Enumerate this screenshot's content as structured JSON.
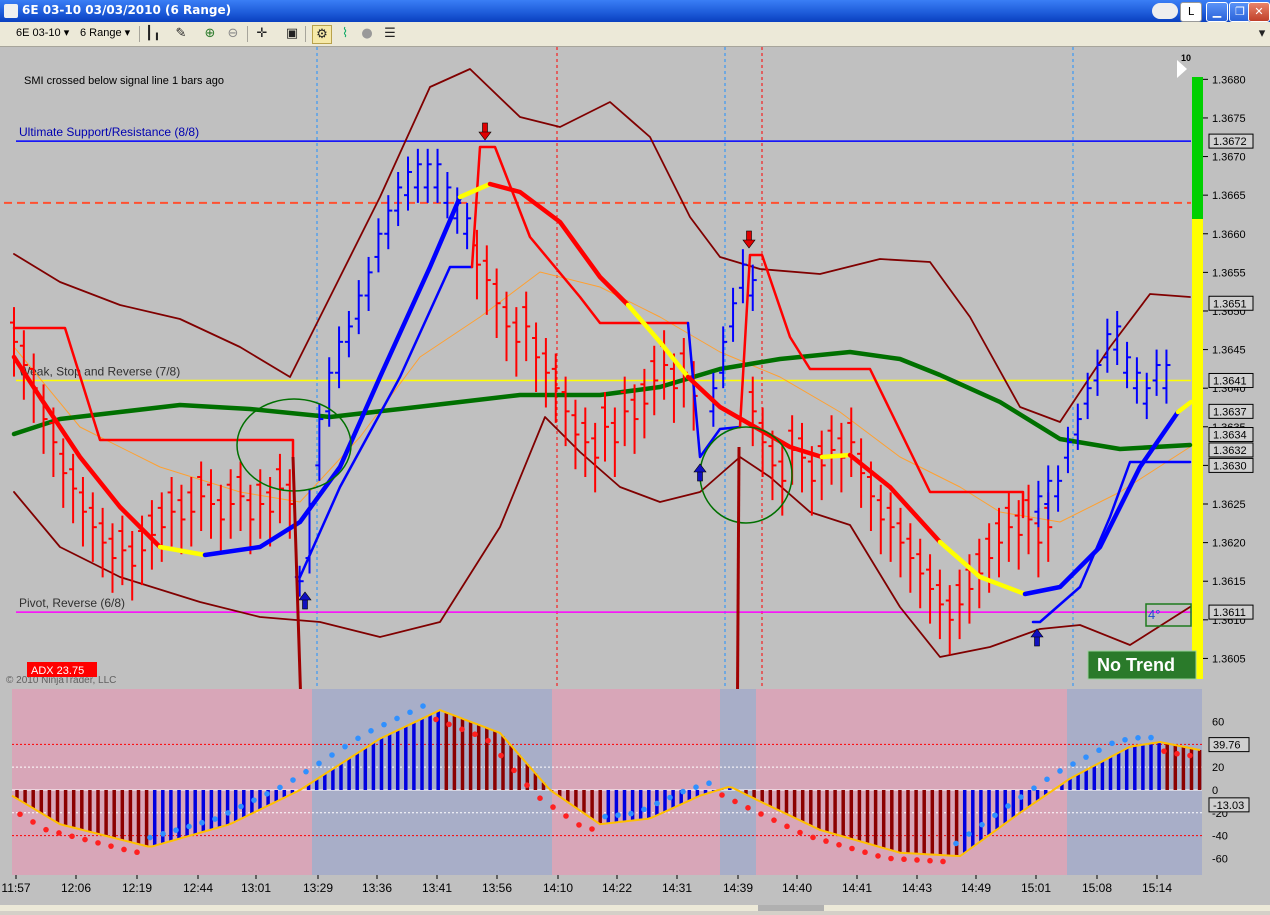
{
  "window": {
    "title": "6E 03-10  03/03/2010 (6 Range)",
    "button_restore": "L"
  },
  "toolbar": {
    "instrument": "6E 03-10",
    "bar_type": "6 Range"
  },
  "chart_data": [
    {
      "type": "line",
      "panel": "price",
      "status_message": "SMI crossed below signal line  1 bars ago",
      "copyright": "© 2010 NinjaTrader, LLC",
      "adx_label": "ADX 23.75",
      "trend_label": "No Trend",
      "angle_label": "4°",
      "corner_marker": "10",
      "ylim": [
        1.36013,
        1.36838
      ],
      "y_ticks": [
        "1.3680",
        "1.3675",
        "1.3670",
        "1.3665",
        "1.3660",
        "1.3655",
        "1.3650",
        "1.3645",
        "1.3640",
        "1.3635",
        "1.3630",
        "1.3625",
        "1.3620",
        "1.3615",
        "1.3610",
        "1.3605"
      ],
      "levels": [
        {
          "name": "Ultimate Support/Resistance (8/8)",
          "price": 1.3672,
          "color": "#0000ff"
        },
        {
          "name": "Weak, Stop and Reverse (7/8)",
          "price": 1.3641,
          "color": "#ffff00"
        },
        {
          "name": "Pivot, Reverse (6/8)",
          "price": 1.3611,
          "color": "#ff00ff"
        },
        {
          "name": "",
          "price": 1.3664,
          "color": "#ff5030",
          "dashed": true
        }
      ],
      "price_tags": [
        "1.3672",
        "1.3651",
        "1.3641",
        "1.3637",
        "1.3634",
        "1.3632",
        "1.3630",
        "1.3611"
      ],
      "bars_blue": [
        {
          "i": 29,
          "h": 1.3617,
          "l": 1.3613
        },
        {
          "i": 30,
          "h": 1.3627,
          "l": 1.3616
        },
        {
          "i": 31,
          "h": 1.3638,
          "l": 1.3628
        },
        {
          "i": 32,
          "h": 1.3644,
          "l": 1.3635
        },
        {
          "i": 33,
          "h": 1.3648,
          "l": 1.364
        },
        {
          "i": 34,
          "h": 1.365,
          "l": 1.3644
        },
        {
          "i": 35,
          "h": 1.3654,
          "l": 1.3647
        },
        {
          "i": 36,
          "h": 1.3657,
          "l": 1.365
        },
        {
          "i": 37,
          "h": 1.3662,
          "l": 1.3655
        },
        {
          "i": 38,
          "h": 1.3665,
          "l": 1.3658
        },
        {
          "i": 39,
          "h": 1.3668,
          "l": 1.3661
        },
        {
          "i": 40,
          "h": 1.367,
          "l": 1.3663
        },
        {
          "i": 41,
          "h": 1.3671,
          "l": 1.3664
        },
        {
          "i": 42,
          "h": 1.3671,
          "l": 1.3664
        },
        {
          "i": 43,
          "h": 1.3671,
          "l": 1.3664
        },
        {
          "i": 44,
          "h": 1.3668,
          "l": 1.3662
        },
        {
          "i": 45,
          "h": 1.3666,
          "l": 1.366
        },
        {
          "i": 46,
          "h": 1.3664,
          "l": 1.3658
        },
        {
          "i": 71,
          "h": 1.3642,
          "l": 1.3635
        },
        {
          "i": 72,
          "h": 1.3648,
          "l": 1.364
        },
        {
          "i": 73,
          "h": 1.3653,
          "l": 1.3646
        },
        {
          "i": 74,
          "h": 1.3658,
          "l": 1.3651
        },
        {
          "i": 75,
          "h": 1.3656,
          "l": 1.365
        },
        {
          "i": 104,
          "h": 1.3628,
          "l": 1.3622
        },
        {
          "i": 105,
          "h": 1.363,
          "l": 1.3623
        },
        {
          "i": 106,
          "h": 1.363,
          "l": 1.3624
        },
        {
          "i": 107,
          "h": 1.3635,
          "l": 1.3629
        },
        {
          "i": 108,
          "h": 1.3638,
          "l": 1.3632
        },
        {
          "i": 109,
          "h": 1.3642,
          "l": 1.3636
        },
        {
          "i": 110,
          "h": 1.3645,
          "l": 1.3639
        },
        {
          "i": 111,
          "h": 1.3649,
          "l": 1.3642
        },
        {
          "i": 112,
          "h": 1.365,
          "l": 1.3643
        },
        {
          "i": 113,
          "h": 1.3646,
          "l": 1.364
        },
        {
          "i": 114,
          "h": 1.3644,
          "l": 1.3638
        },
        {
          "i": 115,
          "h": 1.3642,
          "l": 1.3636
        },
        {
          "i": 116,
          "h": 1.3645,
          "l": 1.3639
        },
        {
          "i": 117,
          "h": 1.3645,
          "l": 1.3638
        }
      ],
      "red_close": [
        1.3646,
        1.3643,
        1.364,
        1.3636,
        1.3633,
        1.3629,
        1.3627,
        1.3624,
        1.3622,
        1.362,
        1.3618,
        1.3619,
        1.3617,
        1.3619,
        1.3621,
        1.3622,
        1.3624,
        1.3623,
        1.3624,
        1.3626,
        1.3625,
        1.3623,
        1.3625,
        1.3626,
        1.3623,
        1.3625,
        1.3624,
        1.3627,
        1.3625,
        0,
        0,
        0,
        0,
        0,
        0,
        0,
        0,
        0,
        0,
        0,
        0,
        0,
        0,
        0,
        0,
        0,
        0,
        1.3656,
        1.3654,
        1.3651,
        1.3648,
        1.3646,
        1.3648,
        1.3644,
        1.3642,
        1.364,
        1.3637,
        1.3634,
        1.3633,
        1.3631,
        1.3635,
        1.3633,
        1.3637,
        1.3636,
        1.3638,
        1.3641,
        1.3643,
        1.364,
        1.3642,
        1.3639,
        0,
        0,
        0,
        0,
        0,
        1.3637,
        1.3633,
        1.363,
        1.3628,
        1.3632,
        1.3631,
        1.3628,
        1.363,
        1.3632,
        1.3631,
        1.3633,
        1.3629,
        1.3626,
        1.3623,
        1.3622,
        1.362,
        1.3618,
        1.3616,
        1.3614,
        1.3612,
        1.361,
        1.3612,
        1.3614,
        1.3616,
        1.3618,
        1.362,
        1.3622,
        1.3621,
        1.3623,
        1.362,
        1.3622
      ],
      "series": [
        {
          "name": "",
          "color": "#ff0000",
          "values_note": "thick red/yellow/blue moving average"
        },
        {
          "name": "",
          "color": "#0000ff"
        },
        {
          "name": "",
          "color": "#008000"
        },
        {
          "name": "",
          "color": "#800000"
        }
      ]
    },
    {
      "type": "bar",
      "panel": "oscillator",
      "ylim": [
        -64,
        78
      ],
      "y_ticks": [
        "60",
        "40",
        "20",
        "0",
        "-20",
        "-40",
        "-60"
      ],
      "value_tags": [
        "39.76",
        "-13.03"
      ],
      "x_tick_labels": [
        "11:57",
        "12:06",
        "12:19",
        "12:44",
        "13:01",
        "13:29",
        "13:36",
        "13:41",
        "13:56",
        "14:10",
        "14:22",
        "14:31",
        "14:39",
        "14:40",
        "14:41",
        "14:43",
        "14:49",
        "15:01",
        "15:08",
        "15:14"
      ]
    }
  ]
}
